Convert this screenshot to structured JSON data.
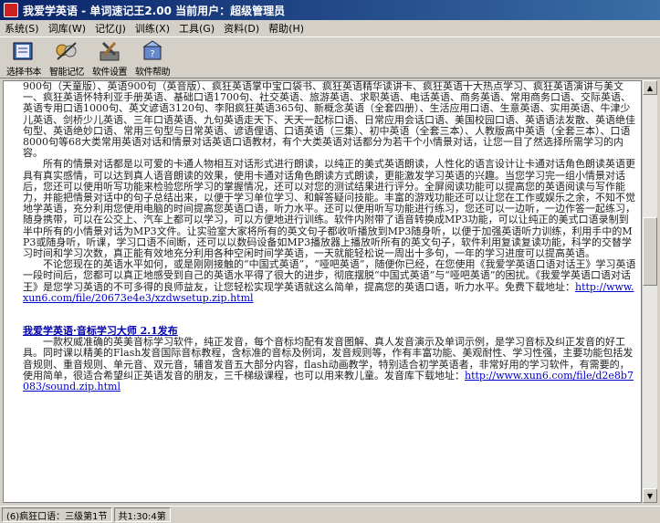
{
  "window": {
    "title": "我爱学英语 - 单词速记王2.00 当前用户：超级管理员"
  },
  "menu": [
    "系统(S)",
    "词库(W)",
    "记忆(J)",
    "训练(X)",
    "工具(G)",
    "资料(D)",
    "帮助(H)"
  ],
  "toolbar": [
    {
      "label": "选择书本",
      "icon": "book-icon"
    },
    {
      "label": "智能记忆",
      "icon": "brain-icon"
    },
    {
      "label": "软件设置",
      "icon": "tools-icon"
    },
    {
      "label": "软件帮助",
      "icon": "help-icon"
    }
  ],
  "content": {
    "p1": "900句（天童版）、英语900句（英音版）、疯狂英语掌中宝口袋书、疯狂英语精华读讲卡、疯狂英语十大热点学习、疯狂英语演讲与美文一、疯狂英语怀特利亚手册英语、基础口语1700句、社交英语、旅游英语、求职英语、电话英语、商务英语、常用商务口语、交际英语、英语专用口语1000句、英文谚语3120句、李阳疯狂英语365句、新概念英语（全套四册）、生活应用口语、生意英语、实用英语、牛津少儿英语、剑桥少儿英语、三年口语英语、九句英语走天下、天天一起标口语、日常应用会话口语、美国校园口语、英语语法发散、英语绝佳句型、英语绝妙口语、常用三句型与日常英语、谚语俚语、口语英语（三集）、初中英语（全套三本）、人教版高中英语（全套三本）、口语8000句等68大类常用英语对话和情景对话英语口语教材，有个大类英语对话都分为若干个小情景对话，让您一目了然选择所需学习的内容。",
    "p2": "所有的情景对话都是以可爱的卡通人物相互对话形式进行朗读，以纯正的美式英语朗读，人性化的语言设计让卡通对话角色朗读英语更具有真实感情，可以达到真人语音朗读的效果，使用卡通对话角色朗读方式朗读，更能激发学习英语的兴趣。当您学习完一组小情景对话后，您还可以使用听写功能来检验您所学习的掌握情况，还可以对您的测试结果进行评分。全屏阅读功能可以提高您的英语阅读与写作能力，并能把情景对话中的句子总结出来，以便于学习单位学习、和解答疑问技能。丰富的游戏功能还可以让您在工作或娱乐之余，不知不觉地学英语，充分利用您使用电脑的时间提高您英语口语，听力水平。还可以使用听写功能进行练习，您还可以一边听，一边作答一起练习，随身携带，可以在公交上、汽车上都可以学习，可以方便地进行训练。软件内附带了语音转换成MP3功能，可以让纯正的美式口语录制到半中所有的小情景对话为MP3文件。让实验室大家将所有的英文句子都收听播放到MP3随身听，以便于加强英语听力训练，利用手中的MP3或随身听，听课，学习口语不间断，还可以以数码设备如MP3播放器上播放听所有的英文句子，软件利用复读复读功能，科学的交替学习时间和学习次数，真正能有效地充分利用各种空闲时间学英语，一天就能轻松说一周出十多句，一年的学习进度可以提高英语。",
    "p3": "不论您现在的英语水平如何，或是刚刚接触的“中国式英语”，“哑吧英语”，随便你已经，在您使用《我爱学英语口语对话王》学习英语一段时间后，您都可以真正地感受到自己的英语水平得了很大的进步，彻底摆脱“中国式英语”与“哑吧英语”的困扰。《我爱学英语口语对话王》是您学习英语的不可多得的良师益友，让您轻松实现学英语就这么简单，提高您的英语口语，听力水平。免费下载地址：",
    "link1": "http://www.xun6.com/file/20673e4e3/xzdwsetup.zip.html",
    "sec_title": "我爱学英语·音标学习大师 2.1发布",
    "p4": "一款权威准确的英美音标学习软件，纯正发音，每个音标均配有发音图解、真人发音演示及单词示例，是学习音标及纠正发音的好工具。同时课以精美的Flash发音国际音标教程，含标准的音标及例词，发音规则等，作有丰富功能、美观耐性、学习性强，主要功能包括发音规则、重音规则、单元音、双元音，辅音发音五大部分内容，flash动画教学，特别适合初学英语者，非常好用的学习软件，有需要的，使用简单，很适合希望纠正英语发音的朋友，三千梯级课程，也可以用来教儿童。发音库下载地址：",
    "link2": "http://www.xun6.com/file/d2e8b7083/sound.zip.html"
  },
  "status": {
    "user": "(6)疯狂口语：三级第1节",
    "count": "共1:30:4第"
  }
}
